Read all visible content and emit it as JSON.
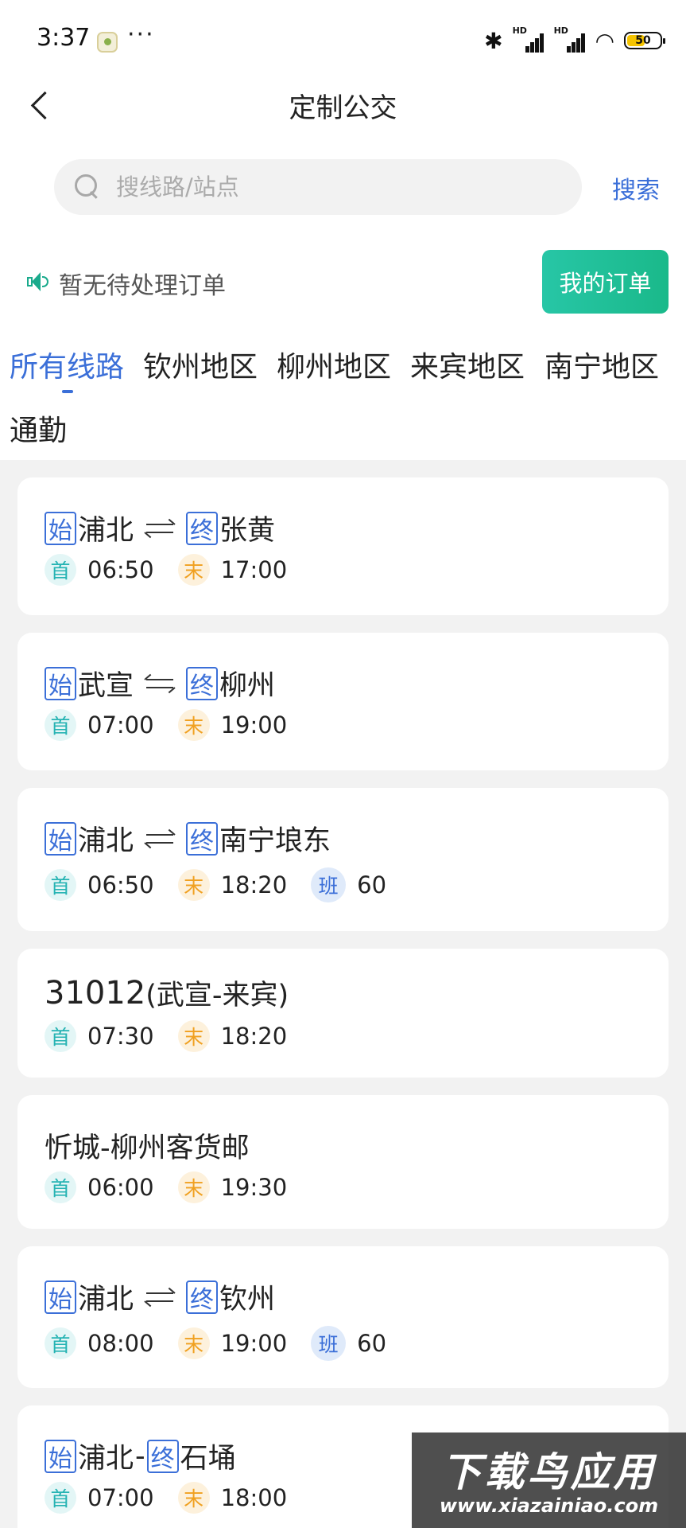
{
  "status_bar": {
    "time": "3:37",
    "dots": "···",
    "battery": "50",
    "hd": "HD"
  },
  "header": {
    "title": "定制公交"
  },
  "search": {
    "placeholder": "搜线路/站点",
    "button_label": "搜索"
  },
  "orders": {
    "notice": "暂无待处理订单",
    "button_label": "我的订单"
  },
  "tabs": [
    "所有线路",
    "钦州地区",
    "柳州地区",
    "来宾地区",
    "南宁地区",
    "通勤"
  ],
  "active_tab": "所有线路",
  "route_tags": {
    "start": "始",
    "end": "终"
  },
  "time_tags": {
    "first": "首",
    "last": "末",
    "frequency": "班"
  },
  "routes": [
    {
      "start": "浦北",
      "end": "张黄",
      "first": "06:50",
      "last": "17:00"
    },
    {
      "start": "武宣",
      "end": "柳州",
      "first": "07:00",
      "last": "19:00"
    },
    {
      "start": "浦北",
      "end": "南宁埌东",
      "first": "06:50",
      "last": "18:20",
      "frequency": "60"
    },
    {
      "code": "31012",
      "name": "(武宣-来宾)",
      "first": "07:30",
      "last": "18:20"
    },
    {
      "name": "忻城-柳州客货邮",
      "first": "06:00",
      "last": "19:30"
    },
    {
      "start": "浦北",
      "end": "钦州",
      "first": "08:00",
      "last": "19:00",
      "frequency": "60"
    },
    {
      "start": "浦北",
      "end": "石埇",
      "separator": "-",
      "first": "07:00",
      "last": "18:00"
    }
  ],
  "watermark": {
    "title": "下载鸟应用",
    "url": "www.xiazainiao.com"
  }
}
